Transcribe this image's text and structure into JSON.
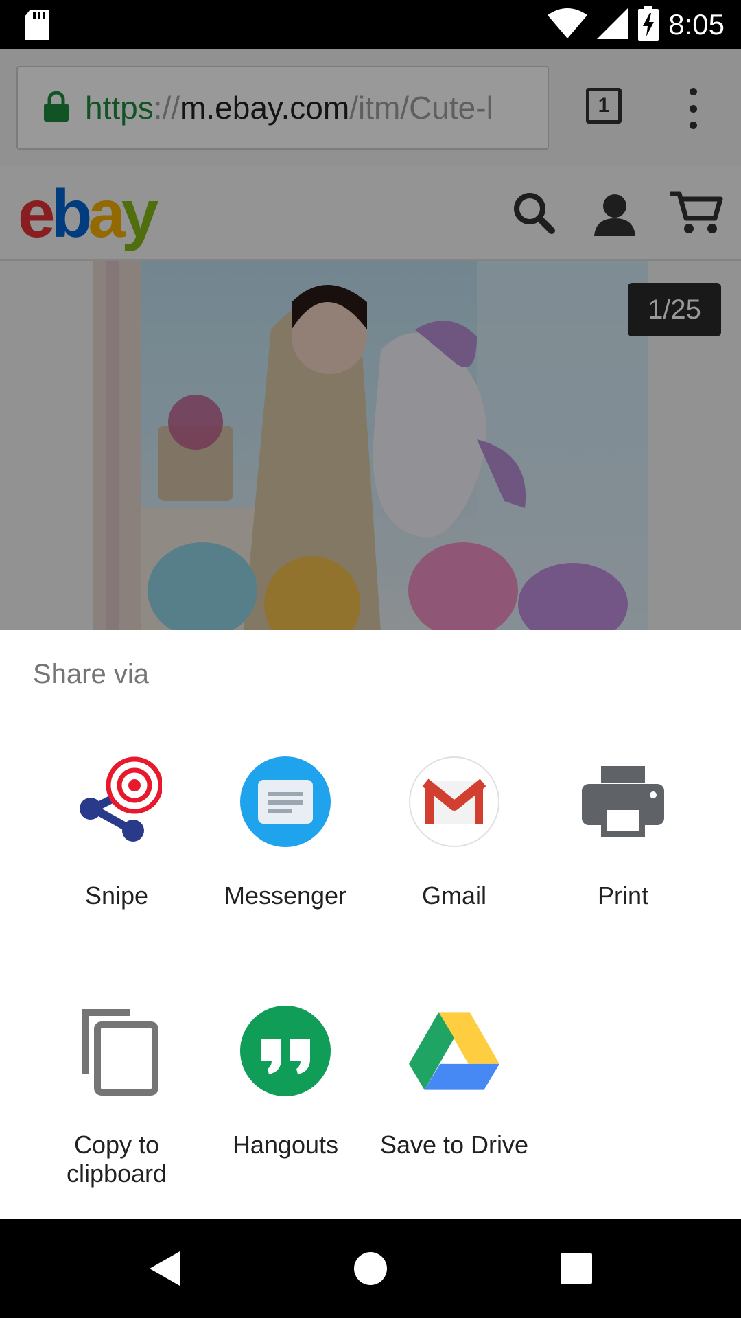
{
  "status_bar": {
    "time": "8:05",
    "icons": [
      "sd-card-icon",
      "wifi-icon",
      "signal-icon",
      "battery-charging-icon"
    ]
  },
  "browser": {
    "url_scheme": "https",
    "url_sep": "://",
    "url_host": "m.ebay.com",
    "url_path": "/itm/Cute-l",
    "tab_count": "1"
  },
  "ebay": {
    "logo": {
      "e": "e",
      "b": "b",
      "a": "a",
      "y": "y"
    },
    "header_icons": [
      "search-icon",
      "account-icon",
      "cart-icon"
    ]
  },
  "product": {
    "image_counter": "1/25"
  },
  "share_sheet": {
    "title": "Share via",
    "targets": [
      {
        "label": "Snipe",
        "icon": "snipe-icon"
      },
      {
        "label": "Messenger",
        "icon": "messenger-icon"
      },
      {
        "label": "Gmail",
        "icon": "gmail-icon"
      },
      {
        "label": "Print",
        "icon": "printer-icon"
      },
      {
        "label": "Copy to clipboard",
        "icon": "copy-icon"
      },
      {
        "label": "Hangouts",
        "icon": "hangouts-icon"
      },
      {
        "label": "Save to Drive",
        "icon": "google-drive-icon"
      }
    ]
  },
  "nav_bar": {
    "buttons": [
      "back-icon",
      "home-icon",
      "recents-icon"
    ]
  },
  "colors": {
    "ebay_red": "#e53238",
    "ebay_blue": "#0064d2",
    "ebay_yellow": "#f5af02",
    "ebay_green": "#86b817",
    "secure_green": "#1e8a3e",
    "messenger_blue": "#1fa3ec",
    "hangouts_green": "#0f9d58"
  }
}
